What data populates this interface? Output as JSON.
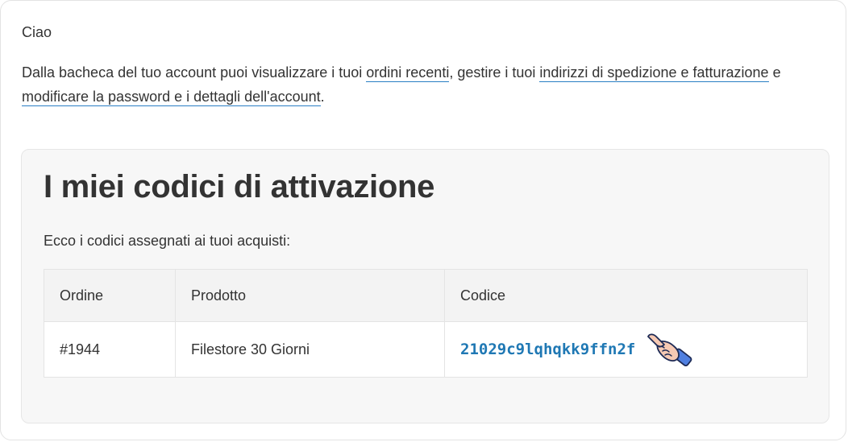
{
  "greeting": "Ciao",
  "intro": {
    "text_1": "Dalla bacheca del tuo account puoi visualizzare i tuoi ",
    "link_orders": "ordini recenti",
    "text_2": ", gestire i tuoi ",
    "link_addresses": "indirizzi di spedizione e fatturazione",
    "text_3": " e ",
    "link_account": "modificare la password e i dettagli dell'account",
    "text_4": "."
  },
  "activation": {
    "title": "I miei codici di attivazione",
    "subtitle": "Ecco i codici assegnati ai tuoi acquisti:",
    "columns": [
      "Ordine",
      "Prodotto",
      "Codice"
    ],
    "rows": [
      {
        "order": "#1944",
        "product": "Filestore 30 Giorni",
        "code": "21029c9lqhqkk9ffn2f"
      }
    ]
  },
  "colors": {
    "link_underline": "#2a7fc4",
    "code_text": "#1f78b4",
    "panel_bg": "#f7f7f7"
  },
  "icons": {
    "copy_hint": "pointing-hand-icon"
  }
}
